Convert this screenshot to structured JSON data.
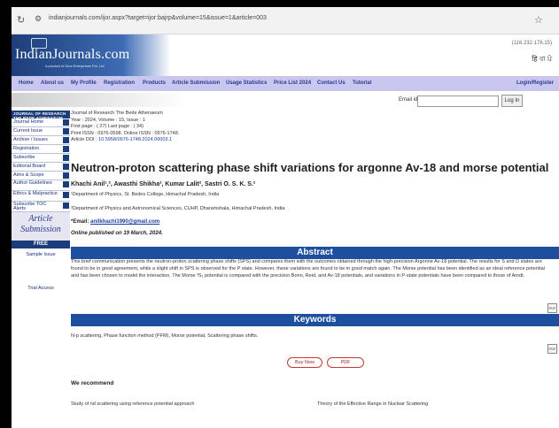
{
  "browser": {
    "url": "indianjournals.com/ijor.aspx?target=ijor:bajrp&volume=15&issue=1&article=003"
  },
  "site": {
    "logo_text": "IndianJournals.com",
    "logo_sub": "A product of Diva Enterprises Pvt. Ltd.",
    "ip": "(116.232.176.15)",
    "langs": "हि বা ਪੰ"
  },
  "nav": {
    "items": [
      "Home",
      "About us",
      "My Profile",
      "Registration",
      "Products",
      "Article Submission",
      "Usage Statistics",
      "Price List 2024",
      "Contact Us",
      "Tutorial"
    ],
    "login": "Login/Register"
  },
  "email": {
    "label": "Email id",
    "login_button": "Log In"
  },
  "sidebar": {
    "header": "JOURNAL OF RESEARCH THE BEDE ATHENAEUM",
    "items": [
      "Journal Home",
      "Current Issue",
      "Archive / Issues",
      "Registration",
      "Subscribe",
      "Editorial Board",
      "Aims & Scope",
      "Author Guidelines",
      "Ethics & Malpractice",
      "Subscribe TOC Alerts"
    ],
    "article_submission_line1": "Article",
    "article_submission_line2": "Submission",
    "free": "FREE",
    "sample_issue": "Sample Issue",
    "trial_access": "Trial Access"
  },
  "article": {
    "journal": "Journal of Research The Bede Athenaeum",
    "year_vol": "Year : 2024, Volume : 15, Issue : 1",
    "pages": "First page : ( 27) Last page : ( 34)",
    "issn": "Print ISSN : 0976-0598. Online ISSN : 0976-1748.",
    "doi_label": "Article DOI : ",
    "doi": "10.5958/0976-1748.2024.00003.1",
    "title": "Neutron-proton scattering phase shift variations for argonne Av-18 and morse potential",
    "authors": "Khachi Anil¹,², Awasthi Shikha², Kumar Lalit², Sastri O. S. K. S.²",
    "aff1": "¹Department of Physics, St. Bedes College, Himachal Pradesh, India",
    "aff2": "²Department of Physics and Astronomical Sciences, CUHP, Dharamshala, Himachal Pradesh, India",
    "email_label": "*Email: ",
    "email": "anilkhachi1990@gmail.com",
    "published": "Online published on 19 March, 2024."
  },
  "abstract": {
    "heading": "Abstract",
    "text": "This brief communication presents the neutron-proton scattering phase shifts (SPS) and compares them with the outcomes obtained through the high-precision Argonne Av-18 potential. The results for S and D states are found to be in good agreement, while a slight shift in SPS is observed for the P state. However, these variations are found to be in good match again. The Morse potential has been identified as an ideal reference potential and has been chosen to model the interaction. The Morse ³S₁ potential is compared with the precision Bonn, Reid, and Av-18 potentials, and variations in P-state potentials have been compared to those of Arndt."
  },
  "keywords": {
    "heading": "Keywords",
    "text": "N-p scattering, Phase function method (PFM), Morse potential, Scattering phase shifts."
  },
  "buttons": {
    "buy": "Buy Now",
    "pdf": "PDF"
  },
  "recommend": {
    "heading": "We recommend",
    "items": [
      "Study of nd scattering using reference potential approach",
      "Theory of the Effective Range in Nuclear Scattering"
    ]
  }
}
